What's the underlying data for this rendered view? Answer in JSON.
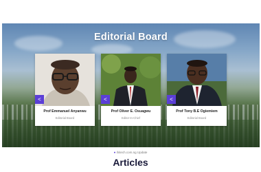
{
  "hero": {
    "title": "Editorial Board"
  },
  "board": [
    {
      "name": "Prof Emmanuel Anyanwu",
      "role": "Editorial Board",
      "share_icon": "share-icon"
    },
    {
      "name": "Prof Oliver E. Osuagwu",
      "role": "Editor-In-Chief",
      "share_icon": "share-icon"
    },
    {
      "name": "Prof Tony B.E Ogiemiem",
      "role": "Editorial Board",
      "share_icon": "share-icon"
    }
  ],
  "footer_link": {
    "icon": "link-icon",
    "text": "ihitech.com.ng Update"
  },
  "section": {
    "title": "Articles"
  },
  "colors": {
    "accent": "#5b3fd6",
    "heading": "#1a1a3a"
  }
}
